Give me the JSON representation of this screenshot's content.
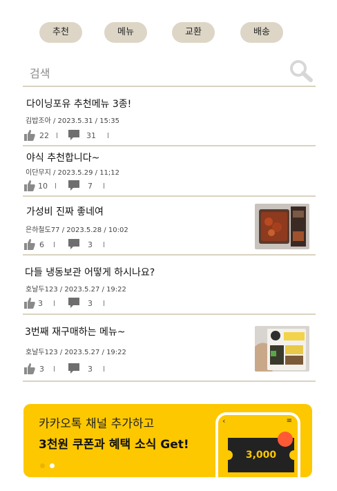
{
  "tabs": [
    {
      "label": "추천"
    },
    {
      "label": "메뉴"
    },
    {
      "label": "교환"
    },
    {
      "label": "배송"
    }
  ],
  "search": {
    "placeholder": "검색"
  },
  "posts": [
    {
      "title": "다이닝포유 추천메뉴 3종!",
      "author": "김밥조아",
      "date": "2023.5.31",
      "time": "15:35",
      "likes": "22",
      "comments": "31",
      "has_image": false
    },
    {
      "title": "야식 추천합니다~",
      "author": "이단무지",
      "date": "2023.5.29",
      "time": "11;12",
      "likes": "10",
      "comments": "7",
      "has_image": false
    },
    {
      "title": "가성비 진짜 좋네여",
      "author": "은하철도77",
      "date": "2023.5.28",
      "time": "10:02",
      "likes": "6",
      "comments": "3",
      "has_image": true
    },
    {
      "title": "다들 냉동보관 어떻게 하시나요?",
      "author": "호날두123",
      "date": "2023.5.27",
      "time": "19:22",
      "likes": "3",
      "comments": "3",
      "has_image": false
    },
    {
      "title": "3번째 재구매하는 메뉴~",
      "author": "호날두123",
      "date": "2023.5.27",
      "time": "19:22",
      "likes": "3",
      "comments": "3",
      "has_image": true
    }
  ],
  "meta_separator": " / ",
  "stat_separator": "l",
  "banner": {
    "line1": "카카오톡 채널 추가하고",
    "line2": "3천원 쿠폰과 혜택 소식 Get!",
    "coupon_amount": "3,000",
    "phone_back": "‹",
    "phone_menu": "≡"
  },
  "colors": {
    "tab_bg": "#ddd6c6",
    "divider": "#d9d2c0",
    "banner_bg": "#fdc800",
    "coupon_bg": "#222222",
    "notification_dot": "#ff5a36"
  },
  "icons": {
    "search": "magnifier",
    "like": "thumbs-up",
    "comment": "speech-bubble"
  }
}
